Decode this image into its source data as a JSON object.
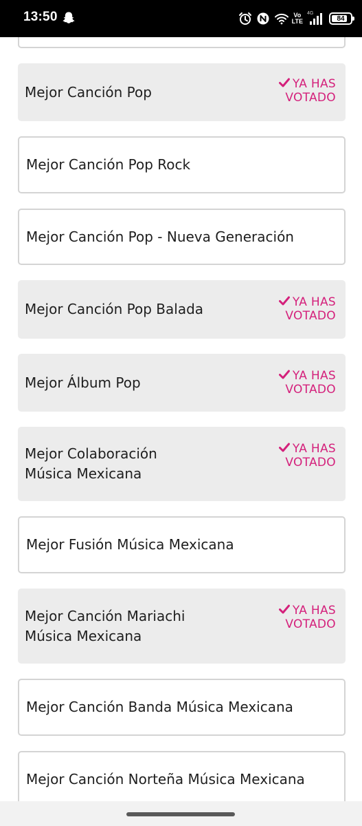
{
  "status_bar": {
    "time": "13:50",
    "network_top": "Vo",
    "network_bottom": "LTE",
    "network_gen": "4G",
    "battery_level": "84",
    "battery_fraction": 0.84,
    "icons": [
      "snapchat-ghost-icon",
      "alarm-icon",
      "nfc-icon",
      "wifi-icon",
      "signal-icon",
      "battery-icon"
    ]
  },
  "list": {
    "items": [
      {
        "title": "",
        "voted": false
      },
      {
        "title": "Mejor Canción Pop",
        "voted": true
      },
      {
        "title": "Mejor Canción Pop Rock",
        "voted": false
      },
      {
        "title": "Mejor Canción Pop - Nueva Generación",
        "voted": false
      },
      {
        "title": "Mejor Canción Pop Balada",
        "voted": true
      },
      {
        "title": "Mejor Álbum Pop",
        "voted": true
      },
      {
        "title": "Mejor Colaboración Música Mexicana",
        "voted": true
      },
      {
        "title": "Mejor Fusión Música Mexicana",
        "voted": false
      },
      {
        "title": "Mejor Canción Mariachi Música Mexicana",
        "voted": true
      },
      {
        "title": "Mejor Canción Banda Música Mexicana",
        "voted": false
      },
      {
        "title": "Mejor Canción Norteña Música Mexicana",
        "voted": false
      }
    ],
    "voted_label_line1": "YA HAS",
    "voted_label_line2": "VOTADO"
  },
  "colors": {
    "accent": "#d4207b",
    "voted_card_bg": "#ececec",
    "card_border": "#d4d4d4",
    "text": "#1e1e1e"
  }
}
